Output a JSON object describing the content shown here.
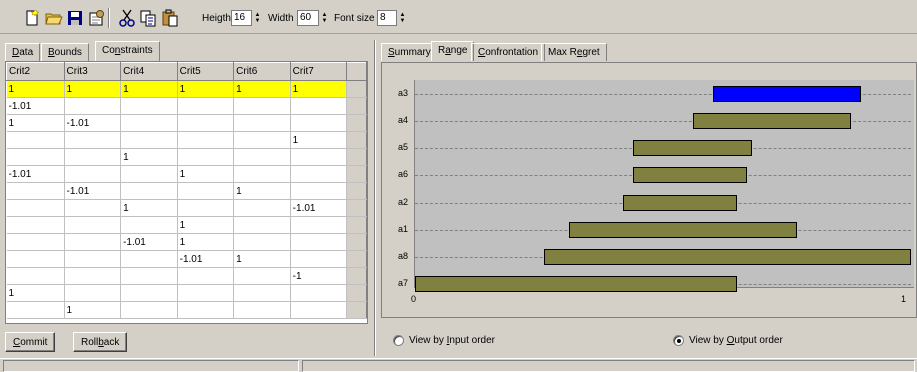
{
  "toolbar": {
    "icons": [
      "new-icon",
      "open-icon",
      "save-icon",
      "export-icon",
      "cut-icon",
      "copy-icon",
      "paste-icon"
    ],
    "height_label": "Heigth",
    "height_value": "16",
    "width_label": "Width",
    "width_value": "60",
    "fontsize_label": "Font size",
    "fontsize_value": "8"
  },
  "left_tabs": {
    "data": {
      "pre": "",
      "accel": "D",
      "post": "ata"
    },
    "bounds": {
      "pre": "",
      "accel": "B",
      "post": "ounds"
    },
    "constraints": {
      "pre": "Co",
      "accel": "n",
      "post": "straints"
    }
  },
  "constraints_table": {
    "columns": [
      "Crit2",
      "Crit3",
      "Crit4",
      "Crit5",
      "Crit6",
      "Crit7"
    ],
    "rows": [
      [
        "1",
        "1",
        "1",
        "1",
        "1",
        "1"
      ],
      [
        "-1.01",
        "",
        "",
        "",
        "",
        ""
      ],
      [
        "1",
        "-1.01",
        "",
        "",
        "",
        ""
      ],
      [
        "",
        "",
        "",
        "",
        "",
        "1"
      ],
      [
        "",
        "",
        "1",
        "",
        "",
        ""
      ],
      [
        "-1.01",
        "",
        "",
        "1",
        "",
        ""
      ],
      [
        "",
        "-1.01",
        "",
        "",
        "1",
        ""
      ],
      [
        "",
        "",
        "1",
        "",
        "",
        "-1.01"
      ],
      [
        "",
        "",
        "",
        "1",
        "",
        ""
      ],
      [
        "",
        "",
        "-1.01",
        "1",
        "",
        ""
      ],
      [
        "",
        "",
        "",
        "-1.01",
        "1",
        ""
      ],
      [
        "",
        "",
        "",
        "",
        "",
        "-1"
      ],
      [
        "1",
        "",
        "",
        "",
        "",
        ""
      ],
      [
        "",
        "1",
        "",
        "",
        "",
        ""
      ]
    ],
    "selected_row": 0
  },
  "buttons": {
    "commit": {
      "pre": "",
      "accel": "C",
      "post": "ommit"
    },
    "rollback": {
      "pre": "Roll",
      "accel": "b",
      "post": "ack"
    }
  },
  "right_tabs": {
    "summary": {
      "pre": "",
      "accel": "S",
      "post": "ummary"
    },
    "range": {
      "pre": "R",
      "accel": "a",
      "post": "nge"
    },
    "confrontation": {
      "pre": "",
      "accel": "C",
      "post": "onfrontation"
    },
    "max_regret": {
      "pre": "Max R",
      "accel": "e",
      "post": "gret"
    }
  },
  "view_options": {
    "input_order": {
      "pre": "View by ",
      "accel": "I",
      "post": "nput order",
      "checked": false
    },
    "output_order": {
      "pre": "View by ",
      "accel": "O",
      "post": "utput order",
      "checked": true
    }
  },
  "chart_data": {
    "type": "bar",
    "orientation": "horizontal-range",
    "xlim": [
      0,
      1
    ],
    "x_ticks": [
      "0",
      "1"
    ],
    "categories": [
      "a3",
      "a4",
      "a5",
      "a6",
      "a2",
      "a1",
      "a8",
      "a7"
    ],
    "ranges": [
      [
        0.6,
        0.9
      ],
      [
        0.56,
        0.88
      ],
      [
        0.44,
        0.68
      ],
      [
        0.44,
        0.67
      ],
      [
        0.42,
        0.65
      ],
      [
        0.31,
        0.77
      ],
      [
        0.26,
        1.0
      ],
      [
        0.0,
        0.65
      ]
    ],
    "highlighted": "a3",
    "colors": {
      "highlight": "#0000ff",
      "bar": "#808040",
      "background": "#c0c0c0"
    }
  }
}
